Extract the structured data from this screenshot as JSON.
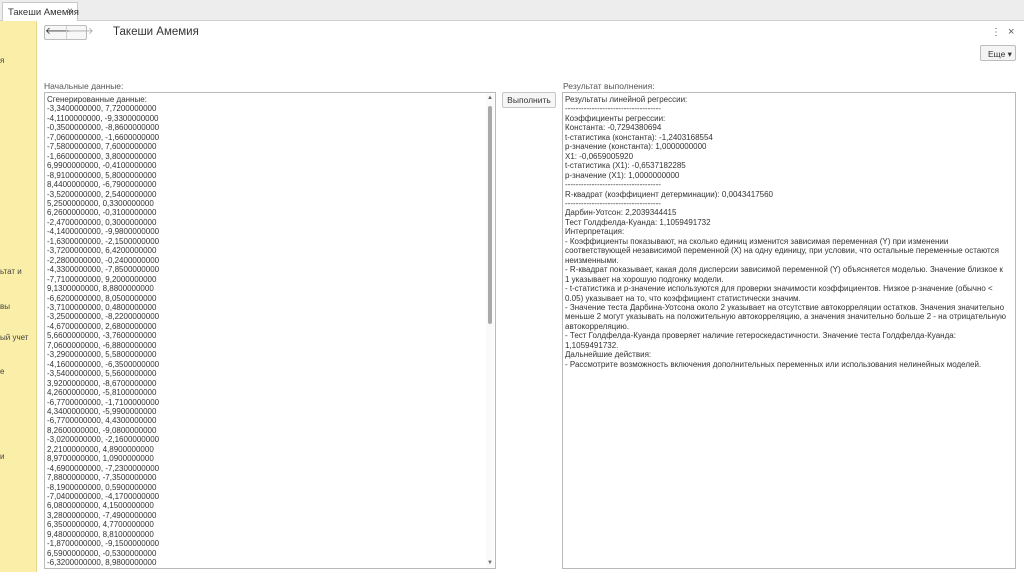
{
  "tabs": [
    {
      "label": "Такеши Амемия",
      "close": "×"
    }
  ],
  "left_panel": {
    "fragments": [
      "я",
      "ьтат и",
      "вы",
      "ый учет",
      "е",
      "и"
    ]
  },
  "header": {
    "back": "🡐",
    "forward": "🡒",
    "title": "Такеши Амемия",
    "kebab": "⋮",
    "close": "×",
    "more_label": "Еще ▾"
  },
  "input": {
    "label": "Начальные данные:",
    "lines": [
      "Сгенерированные данные:",
      "-3,3400000000, 7,7200000000",
      "-4,1100000000, -9,3300000000",
      "-0,3500000000, -8,8600000000",
      "-7,0600000000, -1,6600000000",
      "-7,5800000000, 7,6000000000",
      "-1,6600000000, 3,8000000000",
      "6,9900000000, -0,4100000000",
      "-8,9100000000, 5,8000000000",
      "8,4400000000, -6,7900000000",
      "-3,5200000000, 2,5400000000",
      "5,2500000000, 0,3300000000",
      "6,2600000000, -0,3100000000",
      "-2,4700000000, 0,3000000000",
      "-4,1400000000, -9,9800000000",
      "-1,6300000000, -2,1500000000",
      "-3,7200000000, 6,4200000000",
      "-2,2800000000, -0,2400000000",
      "-4,3300000000, -7,8500000000",
      "-7,7100000000, 9,2000000000",
      "9,1300000000, 8,8800000000",
      "-6,6200000000, 8,0500000000",
      "-3,7100000000, 0,4800000000",
      "-3,2500000000, -8,2200000000",
      "-4,6700000000, 2,6800000000",
      "5,6600000000, -3,7600000000",
      "7,0600000000, -6,8800000000",
      "-3,2900000000, 5,5800000000",
      "-4,1600000000, -6,3500000000",
      "-3,5400000000, 5,5600000000",
      "3,9200000000, -8,6700000000",
      "4,2600000000, -5,8100000000",
      "-6,7700000000, -1,7100000000",
      "4,3400000000, -5,9900000000",
      "-6,7700000000, 4,4300000000",
      "8,2600000000, -9,0800000000",
      "-3,0200000000, -2,1600000000",
      "2,2100000000, 4,8900000000",
      "8,9700000000, 1,0900000000",
      "-4,6900000000, -7,2300000000",
      "7,8800000000, -7,3500000000",
      "-8,1900000000, 0,5900000000",
      "-7,0400000000, -4,1700000000",
      "6,0800000000, 4,1500000000",
      "3,2800000000, -7,4900000000",
      "6,3500000000, 4,7700000000",
      "9,4800000000, 8,8100000000",
      "-1,8700000000, -9,1500000000",
      "6,5900000000, -0,5300000000",
      "-6,3200000000, 8,9800000000"
    ]
  },
  "run_button": "Выполнить",
  "output": {
    "label": "Результат выполнения:",
    "lines": [
      "Результаты линейной регрессии:",
      "------------------------------------",
      "Коэффициенты регрессии:",
      "Константа: -0,7294380694",
      "t-статистика (константа): -1,2403168554",
      "p-значение (константа): 1,0000000000",
      "X1: -0,0659005920",
      "t-статистика (X1): -0,6537182285",
      "p-значение (X1): 1,0000000000",
      "------------------------------------",
      "R-квадрат (коэффициент детерминации): 0,0043417560",
      "------------------------------------",
      "Дарбин-Уотсон: 2,2039344415",
      "Тест Голдфелда-Куанда: 1,1059491732",
      "Интерпретация:",
      "- Коэффициенты показывают, на сколько единиц изменится зависимая переменная (Y) при изменении соответствующей независимой переменной (X) на одну единицу, при условии, что остальные переменные остаются неизменными.",
      "- R-квадрат показывает, какая доля дисперсии зависимой переменной (Y) объясняется моделью. Значение близкое к 1 указывает на хорошую подгонку модели.",
      "- t-статистика и p-значение используются для проверки значимости коэффициентов. Низкое p-значение (обычно < 0.05) указывает на то, что коэффициент статистически значим.",
      "- Значение теста Дарбина-Уотсона около 2 указывает на отсутствие автокорреляции остатков. Значения значительно меньше 2 могут указывать на положительную автокорреляцию, а значения значительно больше 2 - на отрицательную автокорреляцию.",
      "- Тест Голдфелда-Куанда проверяет наличие гетероскедастичности. Значение теста Голдфелда-Куанда: 1,1059491732.",
      "Дальнейшие действия:",
      "- Рассмотрите возможность включения дополнительных переменных или использования нелинейных моделей."
    ]
  }
}
